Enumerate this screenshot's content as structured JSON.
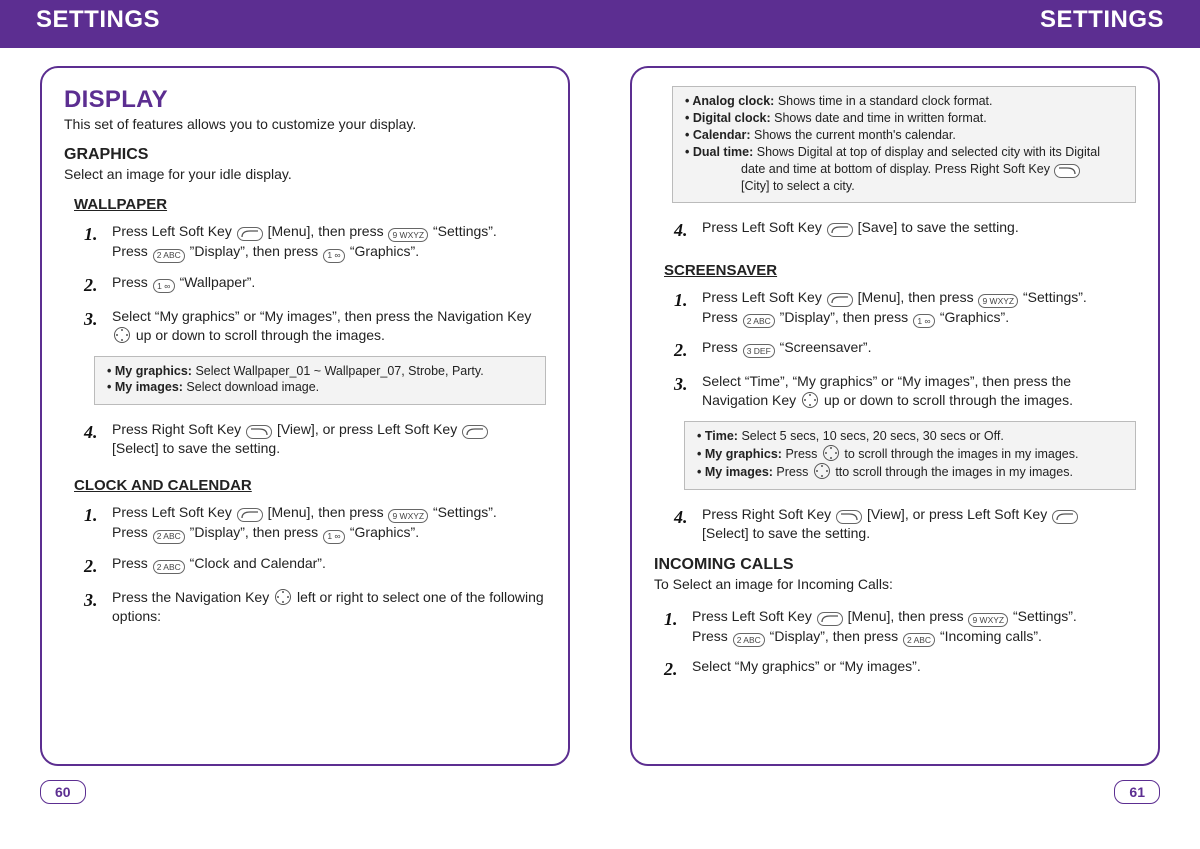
{
  "banner": {
    "left": "SETTINGS",
    "right": "SETTINGS"
  },
  "footer": {
    "left": "60",
    "right": "61"
  },
  "keys": {
    "left_soft": "⌐",
    "right_soft": "¬",
    "k1": "1 ∞",
    "k2": "2 ABC",
    "k3": "3 DEF",
    "k9": "9 WXYZ"
  },
  "p60": {
    "title": "DISPLAY",
    "lead": "This set of features allows you to customize your display.",
    "graphics_h": "GRAPHICS",
    "graphics_sub": "Select an image for your idle display.",
    "wallpaper_h": "WALLPAPER",
    "wp": {
      "s1a": "Press Left Soft Key ",
      "s1b": " [Menu], then press ",
      "s1c": " “Settings”.",
      "s1d": "Press ",
      "s1e": " ”Display”, then press ",
      "s1f": " “Graphics”.",
      "s2a": "Press ",
      "s2b": " “Wallpaper”.",
      "s3a": "Select “My graphics” or “My images”, then press the Navigation Key ",
      "s3b": " up or down to scroll through the images.",
      "note1_b": "My graphics:",
      "note1_t": " Select Wallpaper_01 ~  Wallpaper_07, Strobe, Party.",
      "note2_b": "My images:",
      "note2_t": " Select download image.",
      "s4a": "Press Right Soft Key ",
      "s4b": " [View], or press Left Soft Key ",
      "s4c": "[Select] to save the setting."
    },
    "clock_h": "CLOCK AND CALENDAR",
    "ck": {
      "s1a": "Press Left Soft Key ",
      "s1b": " [Menu], then press ",
      "s1c": " “Settings”.",
      "s1d": "Press ",
      "s1e": " ”Display”, then press ",
      "s1f": " “Graphics”.",
      "s2a": "Press ",
      "s2b": " “Clock and Calendar”.",
      "s3a": "Press the Navigation Key ",
      "s3b": " left or right to select one of the following options:"
    }
  },
  "p61": {
    "top_note": {
      "a_b": "Analog clock:",
      "a_t": " Shows time in a standard clock format.",
      "b_b": "Digital clock:",
      "b_t": " Shows date and time in written format.",
      "c_b": "Calendar:",
      "c_t": " Shows the current month's calendar.",
      "d_b": "Dual time:",
      "d_t": " Shows Digital at top of display and selected city with its Digital",
      "d_t2": "date and time at bottom of display. Press Right Soft Key ",
      "d_t3": "[City] to select a city."
    },
    "s4": {
      "a": "Press Left Soft Key ",
      "b": " [Save] to save the setting."
    },
    "ss_h": "SCREENSAVER",
    "ss": {
      "s1a": "Press Left Soft Key ",
      "s1b": " [Menu], then press ",
      "s1c": " “Settings”.",
      "s1d": "Press ",
      "s1e": " ”Display”, then press ",
      "s1f": " “Graphics”.",
      "s2a": "Press ",
      "s2b": " “Screensaver”.",
      "s3a": "Select “Time”, “My graphics” or “My images”, then press the Navigation Key ",
      "s3b": " up or down to scroll through the images.",
      "n1b": "Time:",
      "n1t": " Select 5 secs, 10 secs, 20 secs, 30 secs or Off.",
      "n2b": "My graphics:",
      "n2t_a": " Press ",
      "n2t_b": " to scroll through the images in my images.",
      "n3b": "My images:",
      "n3t_a": " Press ",
      "n3t_b": " tto scroll through the images in my images.",
      "s4a": "Press Right Soft Key ",
      "s4b": " [View], or press Left Soft Key ",
      "s4c": "[Select] to save the setting."
    },
    "inc_h": "INCOMING CALLS",
    "inc_sub": "To Select an image for Incoming Calls:",
    "inc": {
      "s1a": "Press Left Soft Key ",
      "s1b": " [Menu], then press ",
      "s1c": " “Settings”.",
      "s1d": "Press ",
      "s1e": " “Display”, then press ",
      "s1f": " “Incoming calls”.",
      "s2": "Select “My graphics” or “My images”."
    }
  },
  "nums": {
    "n1": "1.",
    "n2": "2.",
    "n3": "3.",
    "n4": "4."
  }
}
